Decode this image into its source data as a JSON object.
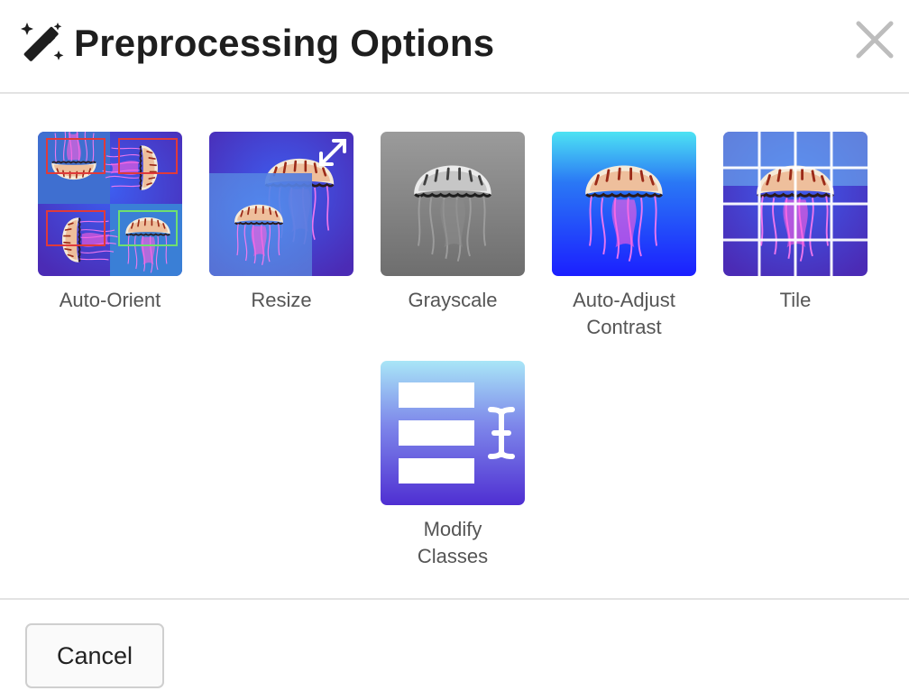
{
  "dialog": {
    "title": "Preprocessing Options",
    "title_icon": "magic-wand-icon",
    "close_icon": "close-icon"
  },
  "options": [
    {
      "label": "Auto-Orient",
      "icon": "auto-orient-thumbnail"
    },
    {
      "label": "Resize",
      "icon": "resize-thumbnail"
    },
    {
      "label": "Grayscale",
      "icon": "grayscale-thumbnail"
    },
    {
      "label": "Auto-Adjust\nContrast",
      "icon": "contrast-thumbnail"
    },
    {
      "label": "Tile",
      "icon": "tile-thumbnail"
    },
    {
      "label": "Modify\nClasses",
      "icon": "modify-classes-thumbnail"
    }
  ],
  "footer": {
    "cancel_label": "Cancel"
  },
  "colors": {
    "accent_purple": "#5a2fd6",
    "accent_blue": "#1e40ff",
    "highlight_cyan": "#3ad7f0",
    "orient_red": "#e03a3a",
    "orient_green": "#6fe06f"
  }
}
